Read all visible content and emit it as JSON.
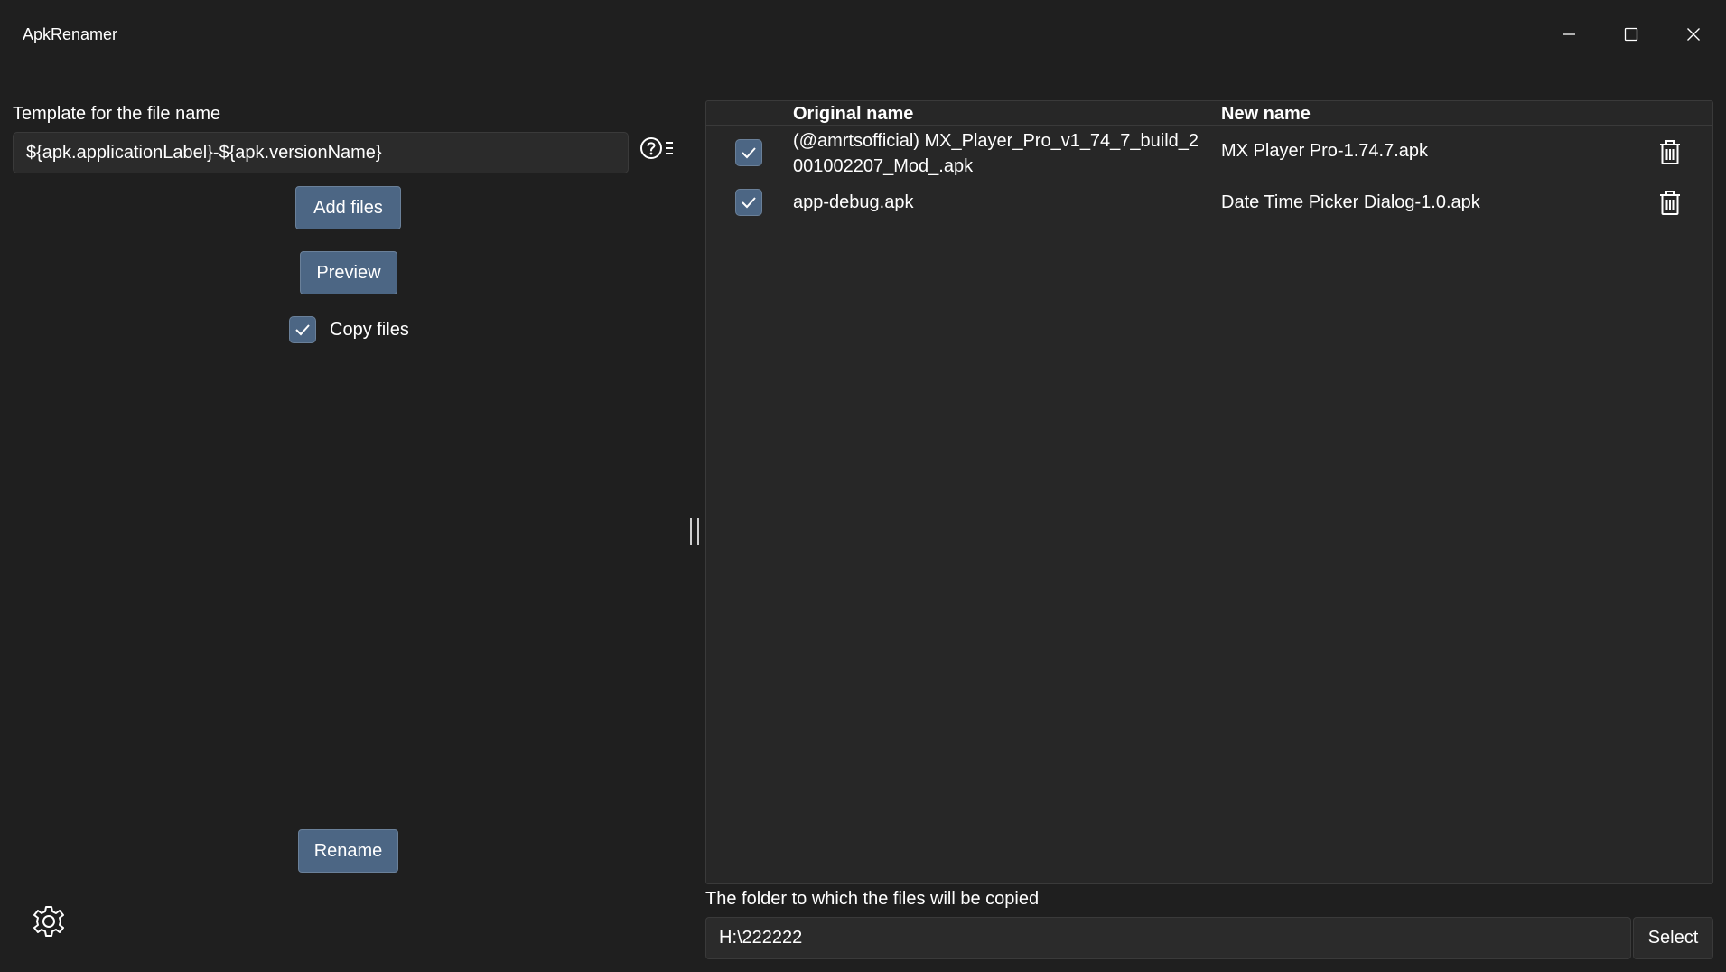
{
  "window": {
    "title": "ApkRenamer"
  },
  "template": {
    "label": "Template for the file name",
    "value": "${apk.applicationLabel}-${apk.versionName}"
  },
  "buttons": {
    "add_files": "Add files",
    "preview": "Preview",
    "rename": "Rename",
    "select": "Select"
  },
  "copy_files": {
    "label": "Copy files",
    "checked": true
  },
  "file_list": {
    "columns": [
      "Original name",
      "New name"
    ],
    "rows": [
      {
        "checked": true,
        "original": "(@amrtsofficial) MX_Player_Pro_v1_74_7_build_2001002207_Mod_.apk",
        "new": "MX Player Pro-1.74.7.apk"
      },
      {
        "checked": true,
        "original": "app-debug.apk",
        "new": "Date Time Picker Dialog-1.0.apk"
      }
    ]
  },
  "destination": {
    "label": "The folder to which the files will be copied",
    "value": "H:\\222222"
  },
  "colors": {
    "background": "#1f1f1f",
    "panel": "#272727",
    "accent_button": "#4c6684",
    "text": "#ffffff"
  },
  "icons": {
    "minimize": "minimize-icon",
    "maximize": "maximize-icon",
    "close": "close-icon",
    "help": "help-list-icon",
    "check": "checkmark-icon",
    "trash": "trash-icon",
    "settings": "gear-icon"
  }
}
